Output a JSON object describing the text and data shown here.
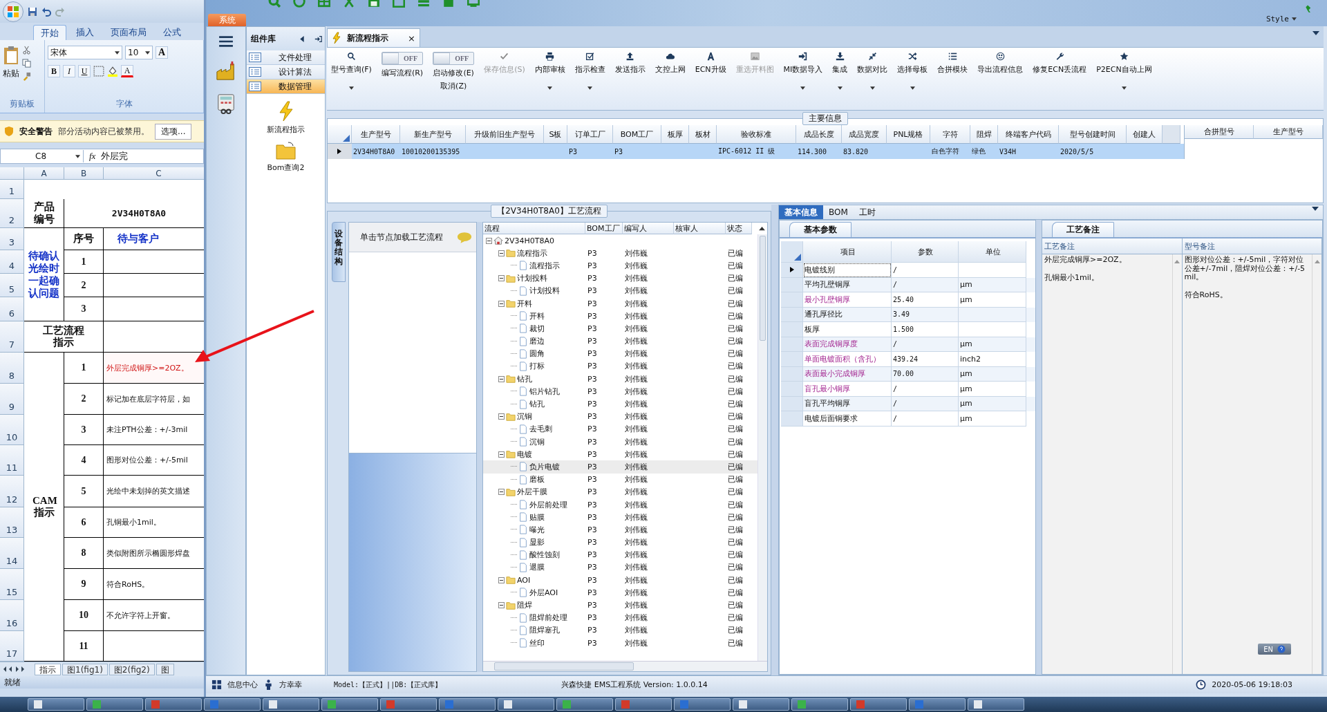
{
  "excel": {
    "ribbon_tabs": [
      {
        "label": "开始",
        "selected": true
      },
      {
        "label": "插入",
        "selected": false
      },
      {
        "label": "页面布局",
        "selected": false
      },
      {
        "label": "公式",
        "selected": false
      }
    ],
    "paste_label": "粘贴",
    "font_name": "宋体",
    "font_size": "10",
    "grow_font": "A",
    "format_buttons": [
      "B",
      "I",
      "U"
    ],
    "font_color": "A",
    "group_labels": [
      "剪贴板",
      "字体"
    ],
    "security": {
      "title": "安全警告",
      "message": "部分活动内容已被禁用。",
      "button": "选项..."
    },
    "name_box": "C8",
    "formula_symbol": "fx",
    "formula": "外层完",
    "columns": [
      "A",
      "B",
      "C"
    ],
    "row_numbers": [
      "1",
      "2",
      "3",
      "4",
      "5",
      "6",
      "7",
      "8",
      "9",
      "10",
      "11",
      "12",
      "13",
      "14",
      "15",
      "16",
      "17"
    ],
    "product": {
      "label": "产品编号",
      "value": "2V34H0T8A0"
    },
    "questions": {
      "label": "待确认光绘时一起确认问题",
      "number_header": "序号",
      "text_header": "待与客户",
      "numbers": [
        "1",
        "2",
        "3"
      ]
    },
    "process_label": "工艺流程指示",
    "cam": {
      "label": "CAM指示",
      "items": [
        {
          "no": "1",
          "text": "外层完成铜厚>=2OZ。",
          "flagged": true
        },
        {
          "no": "2",
          "text": "标记加在底层字符层，如",
          "flagged": false
        },
        {
          "no": "3",
          "text": "未注PTH公差：+/-3mil",
          "flagged": false
        },
        {
          "no": "4",
          "text": "图形对位公差：+/-5mil",
          "flagged": false
        },
        {
          "no": "5",
          "text": "光绘中未划掉的英文描述",
          "flagged": false
        },
        {
          "no": "6",
          "text": "孔铜最小1mil。",
          "flagged": false
        },
        {
          "no": "8",
          "text": "类似附图所示椭圆形焊盘",
          "flagged": false
        },
        {
          "no": "9",
          "text": "符合RoHS。",
          "flagged": false
        },
        {
          "no": "10",
          "text": "不允许字符上开窗。",
          "flagged": false
        },
        {
          "no": "11"
        }
      ]
    },
    "sheet_tabs": [
      {
        "label": "指示",
        "selected": true
      },
      {
        "label": "图1(fig1)",
        "selected": false
      },
      {
        "label": "图2(fig2)",
        "selected": false
      },
      {
        "label": "图",
        "selected": false
      }
    ],
    "status": "就绪"
  },
  "app": {
    "style_menu": "Style",
    "system_tab": "系统",
    "component_panel": {
      "title": "组件库",
      "groups": [
        {
          "label": "文件处理",
          "selected": false
        },
        {
          "label": "设计算法",
          "selected": false
        },
        {
          "label": "数据管理",
          "selected": true
        }
      ],
      "tools": [
        "新流程指示",
        "Bom查询2"
      ]
    },
    "document_tab": {
      "label": "新流程指示",
      "close": "×"
    },
    "toolbar": [
      {
        "kind": "button",
        "label": "型号查询(F)",
        "dropdown": true,
        "disabled": false
      },
      {
        "kind": "toggle",
        "label": "编写流程(R)",
        "switch_label": "OFF",
        "on": false
      },
      {
        "kind": "toggle",
        "label": "启动修改(E)",
        "sublabel": "取消(Z)",
        "switch_label": "OFF",
        "on": false
      },
      {
        "kind": "button",
        "label": "保存信息(S)",
        "dropdown": false,
        "disabled": true
      },
      {
        "kind": "button",
        "label": "内部审核",
        "dropdown": true,
        "disabled": false
      },
      {
        "kind": "button",
        "label": "指示检查",
        "dropdown": true,
        "disabled": false
      },
      {
        "kind": "button",
        "label": "发送指示",
        "dropdown": false,
        "disabled": false
      },
      {
        "kind": "button",
        "label": "文控上网",
        "dropdown": false,
        "disabled": false
      },
      {
        "kind": "button",
        "label": "ECN升级",
        "dropdown": false,
        "disabled": false
      },
      {
        "kind": "button",
        "label": "重选开料图",
        "dropdown": false,
        "disabled": true
      },
      {
        "kind": "button",
        "label": "MI数据导入",
        "dropdown": true,
        "disabled": false
      },
      {
        "kind": "button",
        "label": "集成",
        "dropdown": true,
        "disabled": false
      },
      {
        "kind": "button",
        "label": "数据对比",
        "dropdown": true,
        "disabled": false
      },
      {
        "kind": "button",
        "label": "选择母板",
        "dropdown": true,
        "disabled": false
      },
      {
        "kind": "button",
        "label": "合拼模块",
        "dropdown": false,
        "disabled": false
      },
      {
        "kind": "button",
        "label": "导出流程信息",
        "dropdown": false,
        "disabled": false
      },
      {
        "kind": "button",
        "label": "修复ECN丢流程",
        "dropdown": false,
        "disabled": false
      },
      {
        "kind": "button",
        "label": "P2ECN自动上网",
        "dropdown": true,
        "disabled": false
      }
    ],
    "main_info": {
      "title": "主要信息",
      "columns": [
        "生产型号",
        "新生产型号",
        "升级前旧生产型号",
        "S板",
        "订单工厂",
        "BOM工厂",
        "板厚",
        "板材",
        "验收标准",
        "成品长度",
        "成品宽度",
        "PNL规格",
        "字符",
        "阻焊",
        "终端客户代码",
        "型号创建时间",
        "创建人"
      ],
      "rows": [
        {
          "selected": true,
          "cells": [
            "2V34H0T8A0",
            "10010200135395",
            null,
            null,
            "P3",
            "P3",
            null,
            null,
            "IPC-6012 II 级",
            "114.300",
            "83.820",
            null,
            "白色字符",
            "绿色",
            "V34H",
            "2020/5/5",
            null
          ]
        }
      ],
      "side_columns": [
        "合拼型号",
        "生产型号"
      ]
    },
    "process": {
      "title": "【2V34H0T8A0】工艺流程",
      "side_tab": "设备结构",
      "hint": "单击节点加载工艺流程",
      "columns": [
        "流程",
        "BOM工厂",
        "编写人",
        "核审人",
        "状态"
      ],
      "tree": {
        "label": "2V34H0T8A0",
        "expanded": true,
        "selected": false,
        "children": [
          {
            "label": "流程指示",
            "bom": "P3",
            "writer": "刘伟巍",
            "status": "已编",
            "expanded": true,
            "selected": false,
            "children": [
              {
                "label": "流程指示",
                "bom": "P3",
                "writer": "刘伟巍",
                "status": "已编",
                "selected": false
              }
            ]
          },
          {
            "label": "计划投料",
            "bom": "P3",
            "writer": "刘伟巍",
            "status": "已编",
            "expanded": true,
            "selected": false,
            "children": [
              {
                "label": "计划投料",
                "bom": "P3",
                "writer": "刘伟巍",
                "status": "已编",
                "selected": false
              }
            ]
          },
          {
            "label": "开料",
            "bom": "P3",
            "writer": "刘伟巍",
            "status": "已编",
            "expanded": true,
            "selected": false,
            "children": [
              {
                "label": "开料",
                "bom": "P3",
                "writer": "刘伟巍",
                "status": "已编",
                "selected": false
              },
              {
                "label": "裁切",
                "bom": "P3",
                "writer": "刘伟巍",
                "status": "已编",
                "selected": false
              },
              {
                "label": "磨边",
                "bom": "P3",
                "writer": "刘伟巍",
                "status": "已编",
                "selected": false
              },
              {
                "label": "圆角",
                "bom": "P3",
                "writer": "刘伟巍",
                "status": "已编",
                "selected": false
              },
              {
                "label": "打标",
                "bom": "P3",
                "writer": "刘伟巍",
                "status": "已编",
                "selected": false
              }
            ]
          },
          {
            "label": "钻孔",
            "bom": "P3",
            "writer": "刘伟巍",
            "status": "已编",
            "expanded": true,
            "selected": false,
            "children": [
              {
                "label": "铝片钻孔",
                "bom": "P3",
                "writer": "刘伟巍",
                "status": "已编",
                "selected": false
              },
              {
                "label": "钻孔",
                "bom": "P3",
                "writer": "刘伟巍",
                "status": "已编",
                "selected": false
              }
            ]
          },
          {
            "label": "沉铜",
            "bom": "P3",
            "writer": "刘伟巍",
            "status": "已编",
            "expanded": true,
            "selected": false,
            "children": [
              {
                "label": "去毛刺",
                "bom": "P3",
                "writer": "刘伟巍",
                "status": "已编",
                "selected": false
              },
              {
                "label": "沉铜",
                "bom": "P3",
                "writer": "刘伟巍",
                "status": "已编",
                "selected": false
              }
            ]
          },
          {
            "label": "电镀",
            "bom": "P3",
            "writer": "刘伟巍",
            "status": "已编",
            "expanded": true,
            "selected": false,
            "children": [
              {
                "label": "负片电镀",
                "bom": "P3",
                "writer": "刘伟巍",
                "status": "已编",
                "selected": true
              },
              {
                "label": "磨板",
                "bom": "P3",
                "writer": "刘伟巍",
                "status": "已编",
                "selected": false
              }
            ]
          },
          {
            "label": "外层干膜",
            "bom": "P3",
            "writer": "刘伟巍",
            "status": "已编",
            "expanded": true,
            "selected": false,
            "children": [
              {
                "label": "外层前处理",
                "bom": "P3",
                "writer": "刘伟巍",
                "status": "已编",
                "selected": false
              },
              {
                "label": "贴膜",
                "bom": "P3",
                "writer": "刘伟巍",
                "status": "已编",
                "selected": false
              },
              {
                "label": "曝光",
                "bom": "P3",
                "writer": "刘伟巍",
                "status": "已编",
                "selected": false
              },
              {
                "label": "显影",
                "bom": "P3",
                "writer": "刘伟巍",
                "status": "已编",
                "selected": false
              },
              {
                "label": "酸性蚀刻",
                "bom": "P3",
                "writer": "刘伟巍",
                "status": "已编",
                "selected": false
              },
              {
                "label": "退膜",
                "bom": "P3",
                "writer": "刘伟巍",
                "status": "已编",
                "selected": false
              }
            ]
          },
          {
            "label": "AOI",
            "bom": "P3",
            "writer": "刘伟巍",
            "status": "已编",
            "expanded": true,
            "selected": false,
            "children": [
              {
                "label": "外层AOI",
                "bom": "P3",
                "writer": "刘伟巍",
                "status": "已编",
                "selected": false
              }
            ]
          },
          {
            "label": "阻焊",
            "bom": "P3",
            "writer": "刘伟巍",
            "status": "已编",
            "expanded": true,
            "selected": false,
            "children": [
              {
                "label": "阻焊前处理",
                "bom": "P3",
                "writer": "刘伟巍",
                "status": "已编",
                "selected": false
              },
              {
                "label": "阻焊塞孔",
                "bom": "P3",
                "writer": "刘伟巍",
                "status": "已编",
                "selected": false
              },
              {
                "label": "丝印",
                "bom": "P3",
                "writer": "刘伟巍",
                "status": "已编",
                "selected": false
              }
            ]
          }
        ]
      }
    },
    "detail_tabs": [
      {
        "label": "基本信息",
        "selected": true
      },
      {
        "label": "BOM",
        "selected": false
      },
      {
        "label": "工时",
        "selected": false
      }
    ],
    "params": {
      "title": "基本参数",
      "columns": [
        "项目",
        "参数",
        "单位"
      ],
      "rows": [
        {
          "item": "电镀线别",
          "value": "/",
          "required": false,
          "selected": true
        },
        {
          "item": "平均孔壁铜厚",
          "value": "/",
          "unit": "μm",
          "required": false,
          "selected": false
        },
        {
          "item": "最小孔壁铜厚",
          "value": "25.40",
          "unit": "μm",
          "required": true,
          "selected": false
        },
        {
          "item": "通孔厚径比",
          "value": "3.49",
          "required": false,
          "selected": false
        },
        {
          "item": "板厚",
          "value": "1.500",
          "required": false,
          "selected": false
        },
        {
          "item": "表面完成铜厚度",
          "value": "/",
          "unit": "μm",
          "required": true,
          "selected": false
        },
        {
          "item": "单面电镀面积（含孔）",
          "value": "439.24",
          "unit": "inch2",
          "required": true,
          "selected": false
        },
        {
          "item": "表面最小完成铜厚",
          "value": "70.00",
          "unit": "μm",
          "required": true,
          "selected": false
        },
        {
          "item": "盲孔最小铜厚",
          "value": "/",
          "unit": "μm",
          "required": true,
          "selected": false
        },
        {
          "item": "盲孔平均铜厚",
          "value": "/",
          "unit": "μm",
          "required": false,
          "selected": false
        },
        {
          "item": "电镀后面铜要求",
          "value": "/",
          "unit": "μm",
          "required": false,
          "selected": false
        }
      ]
    },
    "notes": {
      "title": "工艺备注",
      "columns": [
        {
          "header": "工艺备注",
          "paragraphs": [
            "外层完成铜厚>=2OZ。",
            "孔铜最小1mil。"
          ]
        },
        {
          "header": "型号备注",
          "paragraphs": [
            "图形对位公差：+/-5mil，字符对位公差+/-7mil，阻焊对位公差：+/-5mil。",
            "符合RoHS。"
          ]
        }
      ]
    },
    "ime": "EN",
    "status_bar": {
      "info_center": "信息中心",
      "user": "方幸幸",
      "environment": "Model:【正式】||DB:【正式库】",
      "product": "兴森快捷 EMS工程系统 Version: 1.0.0.14",
      "datetime": "2020-05-06 19:18:03"
    }
  }
}
